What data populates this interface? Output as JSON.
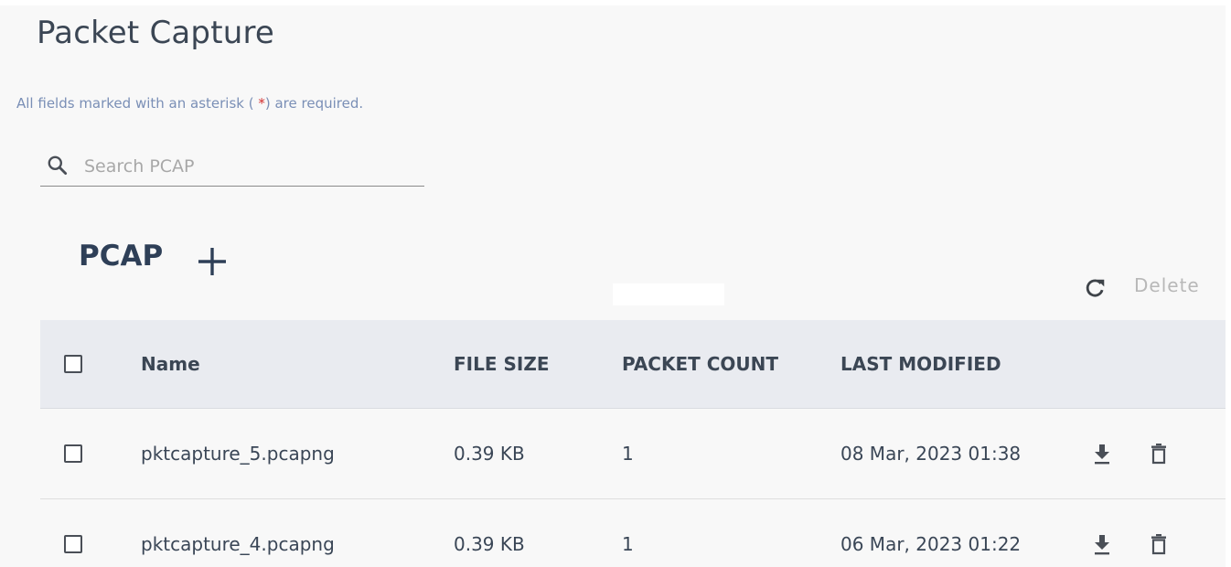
{
  "page": {
    "title": "Packet Capture",
    "required_note_prefix": "All fields marked with an asterisk ( ",
    "required_note_asterisk": "*",
    "required_note_suffix": ") are required."
  },
  "search": {
    "placeholder": "Search PCAP",
    "value": "",
    "icon": "search-icon"
  },
  "section": {
    "title": "PCAP",
    "add_icon": "plus-icon"
  },
  "toolbar": {
    "refresh_icon": "refresh-icon",
    "delete_label": "Delete",
    "delete_enabled": false
  },
  "table": {
    "columns": [
      "Name",
      "FILE SIZE",
      "PACKET COUNT",
      "LAST MODIFIED"
    ],
    "rows": [
      {
        "name": "pktcapture_5.pcapng",
        "file_size": "0.39 KB",
        "packet_count": "1",
        "last_modified": "08 Mar, 2023 01:38",
        "checked": false
      },
      {
        "name": "pktcapture_4.pcapng",
        "file_size": "0.39 KB",
        "packet_count": "1",
        "last_modified": "06 Mar, 2023 01:22",
        "checked": false
      }
    ],
    "row_actions": [
      "download-icon",
      "trash-icon"
    ]
  },
  "colors": {
    "header_bg": "#e9ebf0",
    "title_text": "#3b4654",
    "hint_text": "#7a8fb6",
    "asterisk": "#d32f2f",
    "disabled_text": "#b8b8b8"
  }
}
